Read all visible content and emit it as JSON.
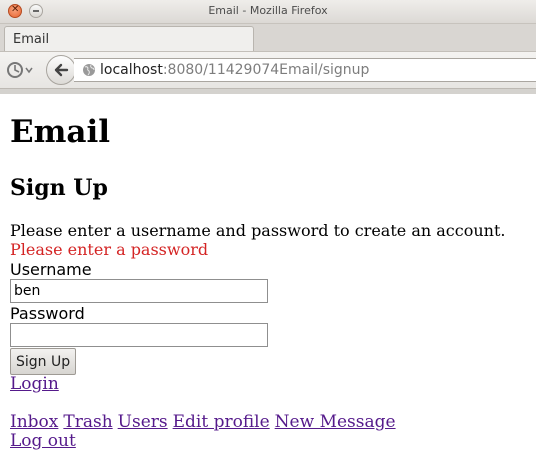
{
  "window": {
    "title": "Email - Mozilla Firefox"
  },
  "tab": {
    "label": "Email"
  },
  "navbar": {
    "url_host": "localhost",
    "url_rest": ":8080/11429074Email/signup"
  },
  "page": {
    "heading": "Email",
    "subheading": "Sign Up",
    "instructions": "Please enter a username and password to create an account.",
    "error": "Please enter a password",
    "form": {
      "username_label": "Username",
      "username_value": "ben",
      "password_label": "Password",
      "password_value": "",
      "submit_label": "Sign Up"
    },
    "login_link": "Login",
    "nav_links": [
      "Inbox",
      "Trash",
      "Users",
      "Edit profile",
      "New Message"
    ],
    "logout_link": "Log out"
  },
  "colors": {
    "error": "#d42424",
    "visited_link": "#551a8b"
  },
  "icons": {
    "window_close": "close-icon",
    "window_minimize": "minimize-icon",
    "history": "history-icon",
    "back": "back-arrow-icon",
    "site_identity": "globe-icon"
  }
}
